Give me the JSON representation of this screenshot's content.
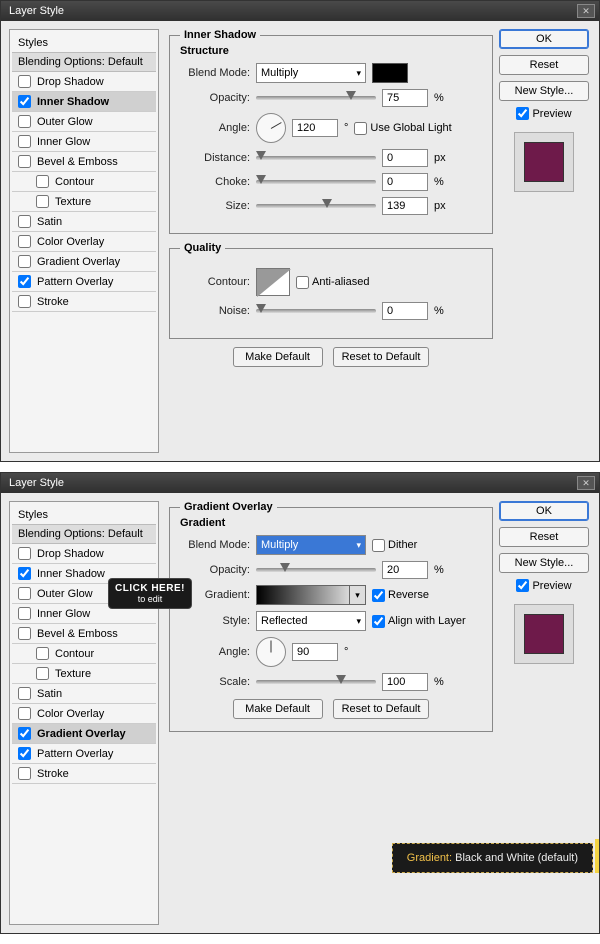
{
  "dialog1": {
    "title": "Layer Style",
    "styles_header": "Styles",
    "blending": "Blending Options: Default",
    "items": [
      {
        "label": "Drop Shadow",
        "checked": false,
        "bold": false,
        "selected": false
      },
      {
        "label": "Inner Shadow",
        "checked": true,
        "bold": true,
        "selected": true
      },
      {
        "label": "Outer Glow",
        "checked": false,
        "bold": false,
        "selected": false
      },
      {
        "label": "Inner Glow",
        "checked": false,
        "bold": false,
        "selected": false
      },
      {
        "label": "Bevel & Emboss",
        "checked": false,
        "bold": false,
        "selected": false
      },
      {
        "label": "Contour",
        "checked": false,
        "bold": false,
        "selected": false,
        "indent": true
      },
      {
        "label": "Texture",
        "checked": false,
        "bold": false,
        "selected": false,
        "indent": true
      },
      {
        "label": "Satin",
        "checked": false,
        "bold": false,
        "selected": false
      },
      {
        "label": "Color Overlay",
        "checked": false,
        "bold": false,
        "selected": false
      },
      {
        "label": "Gradient Overlay",
        "checked": false,
        "bold": false,
        "selected": false
      },
      {
        "label": "Pattern Overlay",
        "checked": true,
        "bold": false,
        "selected": false
      },
      {
        "label": "Stroke",
        "checked": false,
        "bold": false,
        "selected": false
      }
    ],
    "panel_title": "Inner Shadow",
    "structure": {
      "label": "Structure",
      "blend_mode": {
        "label": "Blend Mode:",
        "value": "Multiply"
      },
      "opacity": {
        "label": "Opacity:",
        "value": "75",
        "unit": "%",
        "pct": 75
      },
      "angle": {
        "label": "Angle:",
        "value": "120",
        "unit": "°"
      },
      "use_global": {
        "label": "Use Global Light",
        "checked": false
      },
      "distance": {
        "label": "Distance:",
        "value": "0",
        "unit": "px",
        "pct": 0
      },
      "choke": {
        "label": "Choke:",
        "value": "0",
        "unit": "%",
        "pct": 0
      },
      "size": {
        "label": "Size:",
        "value": "139",
        "unit": "px",
        "pct": 55
      }
    },
    "quality": {
      "label": "Quality",
      "contour": {
        "label": "Contour:"
      },
      "anti": {
        "label": "Anti-aliased",
        "checked": false
      },
      "noise": {
        "label": "Noise:",
        "value": "0",
        "unit": "%",
        "pct": 0
      }
    },
    "make_default": "Make Default",
    "reset_default": "Reset to Default",
    "right": {
      "ok": "OK",
      "reset": "Reset",
      "new_style": "New Style...",
      "preview": {
        "label": "Preview",
        "checked": true
      }
    }
  },
  "dialog2": {
    "title": "Layer Style",
    "styles_header": "Styles",
    "blending": "Blending Options: Default",
    "items": [
      {
        "label": "Drop Shadow",
        "checked": false,
        "bold": false,
        "selected": false
      },
      {
        "label": "Inner Shadow",
        "checked": true,
        "bold": false,
        "selected": false
      },
      {
        "label": "Outer Glow",
        "checked": false,
        "bold": false,
        "selected": false
      },
      {
        "label": "Inner Glow",
        "checked": false,
        "bold": false,
        "selected": false
      },
      {
        "label": "Bevel & Emboss",
        "checked": false,
        "bold": false,
        "selected": false
      },
      {
        "label": "Contour",
        "checked": false,
        "bold": false,
        "selected": false,
        "indent": true
      },
      {
        "label": "Texture",
        "checked": false,
        "bold": false,
        "selected": false,
        "indent": true
      },
      {
        "label": "Satin",
        "checked": false,
        "bold": false,
        "selected": false
      },
      {
        "label": "Color Overlay",
        "checked": false,
        "bold": false,
        "selected": false
      },
      {
        "label": "Gradient Overlay",
        "checked": true,
        "bold": true,
        "selected": true
      },
      {
        "label": "Pattern Overlay",
        "checked": true,
        "bold": false,
        "selected": false
      },
      {
        "label": "Stroke",
        "checked": false,
        "bold": false,
        "selected": false
      }
    ],
    "panel_title": "Gradient Overlay",
    "gradient": {
      "label": "Gradient",
      "blend_mode": {
        "label": "Blend Mode:",
        "value": "Multiply"
      },
      "dither": {
        "label": "Dither",
        "checked": false
      },
      "opacity": {
        "label": "Opacity:",
        "value": "20",
        "unit": "%",
        "pct": 20
      },
      "gradient": {
        "label": "Gradient:"
      },
      "reverse": {
        "label": "Reverse",
        "checked": true
      },
      "style": {
        "label": "Style:",
        "value": "Reflected"
      },
      "align": {
        "label": "Align with Layer",
        "checked": true
      },
      "angle": {
        "label": "Angle:",
        "value": "90",
        "unit": "°"
      },
      "scale": {
        "label": "Scale:",
        "value": "100",
        "unit": "%",
        "pct": 67
      }
    },
    "make_default": "Make Default",
    "reset_default": "Reset to Default",
    "right": {
      "ok": "OK",
      "reset": "Reset",
      "new_style": "New Style...",
      "preview": {
        "label": "Preview",
        "checked": true
      }
    },
    "hint": {
      "l1": "CLICK HERE!",
      "l2": "to edit"
    },
    "tooltip": {
      "prefix": "Gradient:",
      "name": " Black and White (default)"
    }
  }
}
